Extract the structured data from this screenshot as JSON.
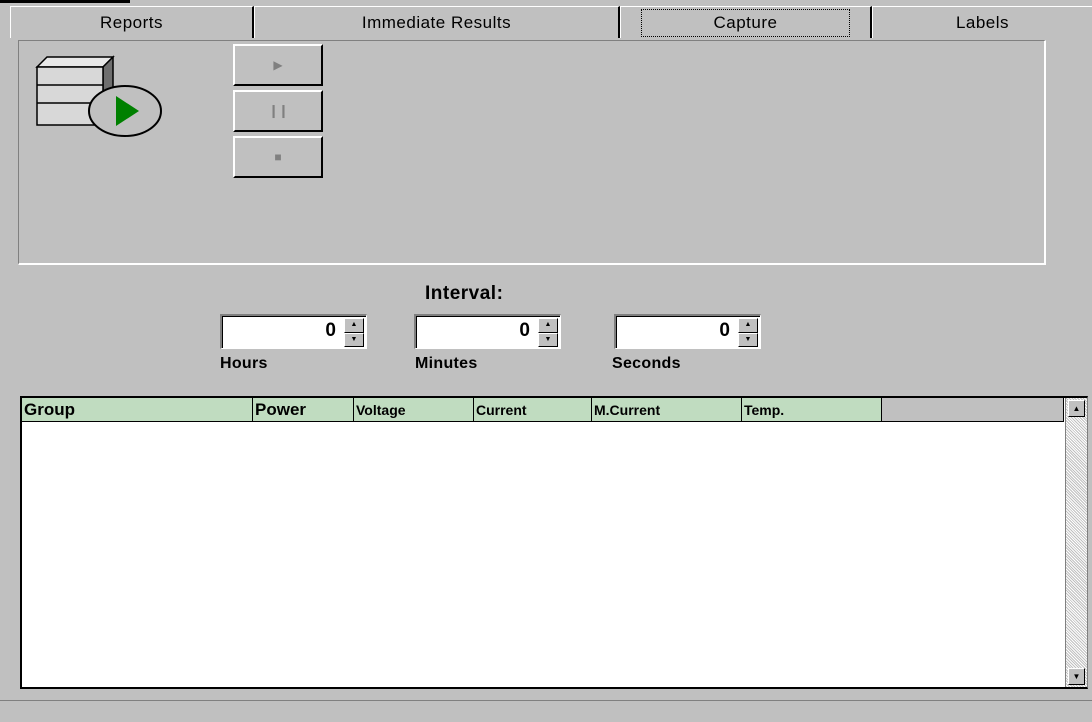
{
  "tabs": [
    {
      "label": "Reports"
    },
    {
      "label": "Immediate Results"
    },
    {
      "label": "Capture",
      "active": true
    },
    {
      "label": "Labels"
    }
  ],
  "capture": {
    "icon": "capture-server-play-icon",
    "play_icon": "play-icon",
    "pause_icon": "pause-icon",
    "stop_icon": "stop-icon"
  },
  "interval": {
    "title": "Interval:",
    "hours": {
      "value": "0",
      "label": "Hours"
    },
    "minutes": {
      "value": "0",
      "label": "Minutes"
    },
    "seconds": {
      "value": "0",
      "label": "Seconds"
    }
  },
  "table": {
    "columns": [
      "Group",
      "Power",
      "Voltage",
      "Current",
      "M.Current",
      "Temp."
    ],
    "rows": []
  },
  "colors": {
    "background": "#c0c0c0",
    "header_bg": "#c0dcc0",
    "play_green": "#008000"
  }
}
